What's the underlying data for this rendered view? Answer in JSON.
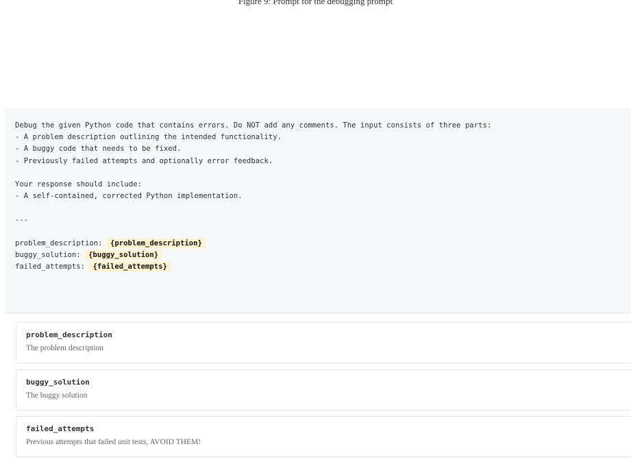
{
  "header": {
    "caption": "Figure 9: Prompt for the debugging prompt"
  },
  "prompt": {
    "intro": "Debug the given Python code that contains errors. Do NOT add any comments. The input consists of three parts:",
    "input_parts": [
      "- A problem description outlining the intended functionality.",
      "- A buggy code that needs to be fixed.",
      "- Previously failed attempts and optionally error feedback."
    ],
    "response_heading": "Your response should include:",
    "response_items": [
      "- A self-contained, corrected Python implementation."
    ],
    "separator": "---",
    "fields": [
      {
        "label": "problem_description: ",
        "placeholder": "{problem_description}"
      },
      {
        "label": "buggy_solution: ",
        "placeholder": "{buggy_solution}"
      },
      {
        "label": "failed_attempts: ",
        "placeholder": "{failed_attempts}"
      }
    ]
  },
  "parameters": [
    {
      "name": "problem_description",
      "description": "The problem description"
    },
    {
      "name": "buggy_solution",
      "description": "The buggy solution"
    },
    {
      "name": "failed_attempts",
      "description": "Previous attempts that failed unit tests, AVOID THEM!"
    }
  ]
}
